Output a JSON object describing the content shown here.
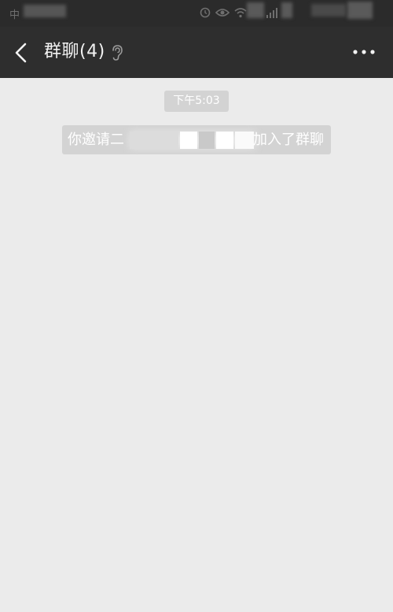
{
  "status_bar": {
    "carrier": "中"
  },
  "header": {
    "title": "群聊(4)"
  },
  "chat": {
    "time": "下午5:03",
    "system_notice": {
      "prefix": "你邀请二",
      "suffix": "加入了群聊"
    }
  },
  "colors": {
    "status_bar_bg": "#2b2b2b",
    "nav_bar_bg": "#2e2e2e",
    "chat_bg": "#ebebeb",
    "pill_bg": "#d3d3d3",
    "pill_text": "#ffffff"
  },
  "icons": {
    "back": "chevron-left-icon",
    "ear": "ear-icon",
    "more": "more-dots-icon"
  }
}
